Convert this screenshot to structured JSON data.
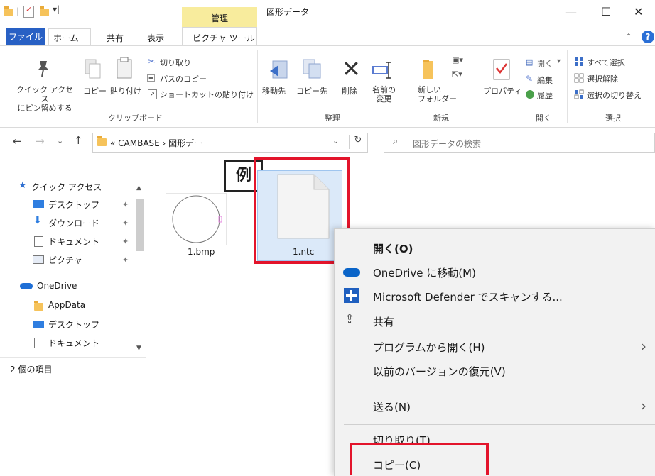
{
  "titlebar": {
    "manage_tab": "管理",
    "window_title": "図形データ",
    "minimize": "—",
    "maximize": "☐",
    "close": "✕"
  },
  "ribbon_tabs": {
    "file": "ファイル",
    "home": "ホーム",
    "share": "共有",
    "view": "表示",
    "picture_tools": "ピクチャ ツール"
  },
  "ribbon": {
    "pin_quick_access": "クイック アクセス\nにピン留めする",
    "copy": "コピー",
    "paste": "貼り付け",
    "cut": "切り取り",
    "copy_path": "パスのコピー",
    "paste_shortcut": "ショートカットの貼り付け",
    "move_to": "移動先",
    "copy_to": "コピー先",
    "delete": "削除",
    "rename": "名前の\n変更",
    "new_folder": "新しい\nフォルダー",
    "properties": "プロパティ",
    "open": "開く",
    "edit": "編集",
    "history": "履歴",
    "select_all": "すべて選択",
    "select_none": "選択解除",
    "invert_selection": "選択の切り替え",
    "group_clipboard": "クリップボード",
    "group_organize": "整理",
    "group_new": "新規",
    "group_open": "開く",
    "group_select": "選択"
  },
  "address": {
    "path": "« CAMBASE › 図形デー",
    "search_placeholder": "図形データの検索"
  },
  "nav": {
    "quick_access": "クイック アクセス",
    "items": [
      "デスクトップ",
      "ダウンロード",
      "ドキュメント",
      "ピクチャ"
    ],
    "onedrive": "OneDrive",
    "onedrive_items": [
      "AppData",
      "デスクトップ",
      "ドキュメント"
    ]
  },
  "status": {
    "count": "2 個の項目"
  },
  "files": {
    "bmp": "1.bmp",
    "ntc": "1.ntc"
  },
  "annotation": {
    "example": "例"
  },
  "context_menu": {
    "open": "開く(O)",
    "onedrive_move": "OneDrive に移動(M)",
    "defender": "Microsoft Defender でスキャンする...",
    "share": "共有",
    "open_with": "プログラムから開く(H)",
    "restore": "以前のバージョンの復元(V)",
    "send_to": "送る(N)",
    "cut": "切り取り(T)",
    "copy": "コピー(C)"
  },
  "colors": {
    "accent": "#2860c4",
    "highlight": "#e3142b",
    "manage": "#f8ec9d"
  }
}
